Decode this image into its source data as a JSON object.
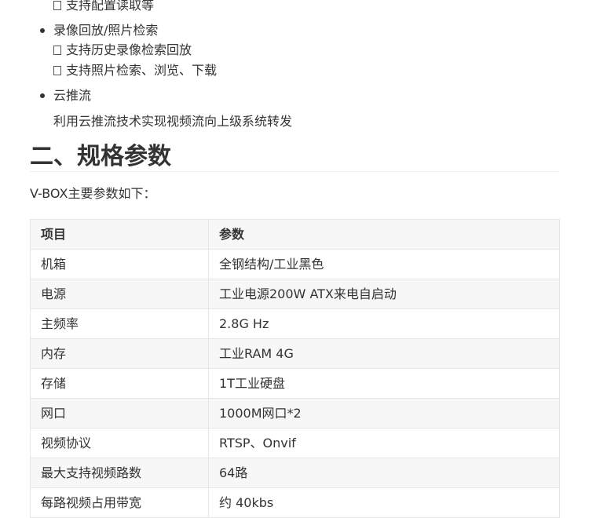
{
  "features": [
    {
      "title": "",
      "subs": [
        "支持配置读取等"
      ]
    },
    {
      "title": "录像回放/照片检索",
      "subs": [
        "支持历史录像检索回放",
        "支持照片检索、浏览、下载"
      ]
    },
    {
      "title": "云推流",
      "description": "利用云推流技术实现视频流向上级系统转发"
    }
  ],
  "section": {
    "title": "二、规格参数",
    "intro": "V-BOX主要参数如下："
  },
  "table": {
    "headers": [
      "项目",
      "参数"
    ],
    "rows": [
      [
        "机箱",
        "全钢结构/工业黑色"
      ],
      [
        "电源",
        "工业电源200W ATX来电自启动"
      ],
      [
        "主频率",
        "2.8G Hz"
      ],
      [
        "内存",
        "工业RAM 4G"
      ],
      [
        "存储",
        "1T工业硬盘"
      ],
      [
        "网口",
        "1000M网口*2"
      ],
      [
        "视频协议",
        "RTSP、Onvif"
      ],
      [
        "最大支持视频路数",
        "64路"
      ],
      [
        "每路视频占用带宽",
        "约 40kbs"
      ]
    ]
  },
  "colors": {
    "text": "#333333",
    "border": "#e6e6e6",
    "stripe": "#f7f7f7"
  }
}
